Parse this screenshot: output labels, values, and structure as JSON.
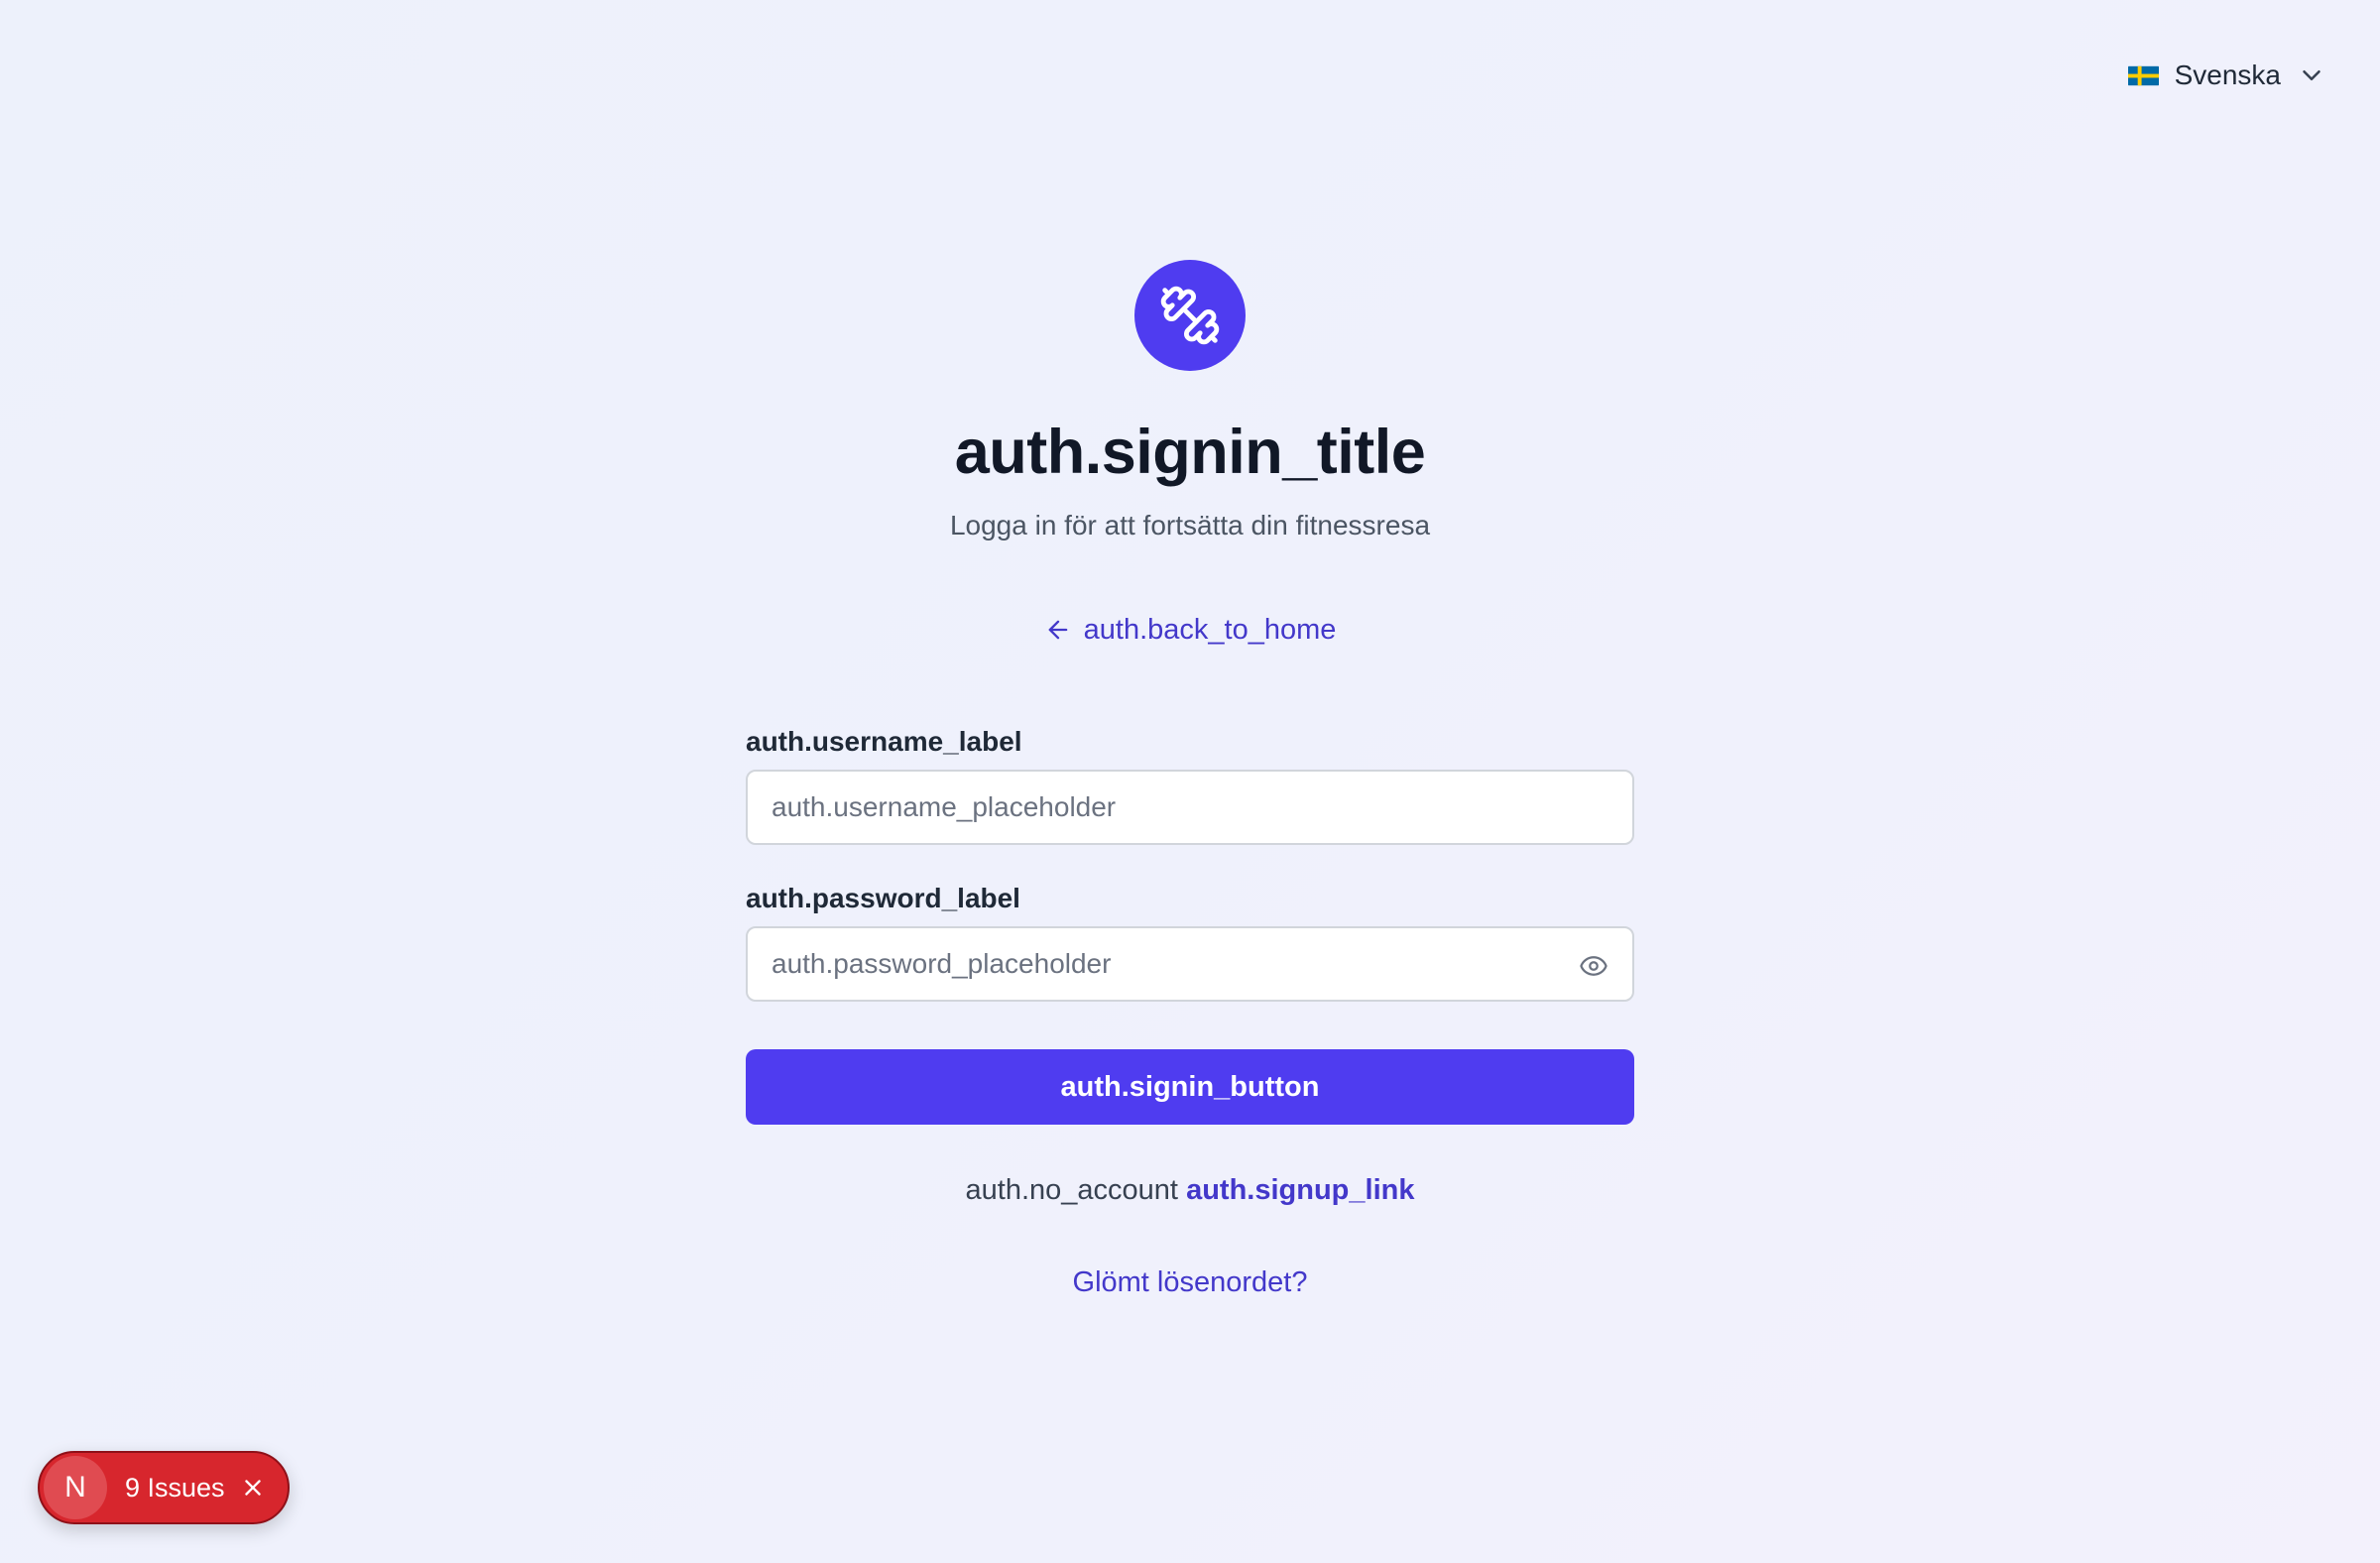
{
  "colors": {
    "accent": "#4f3cf0",
    "link": "#4338ca",
    "badge_red": "#d7262d"
  },
  "language": {
    "flag": "swedish-flag-icon",
    "label": "Svenska"
  },
  "logo": {
    "icon": "dumbbell-icon"
  },
  "auth": {
    "title": "auth.signin_title",
    "subtitle": "Logga in för att fortsätta din fitnessresa",
    "back_to_home": "auth.back_to_home",
    "username_label": "auth.username_label",
    "username_placeholder": "auth.username_placeholder",
    "username_value": "",
    "password_label": "auth.password_label",
    "password_placeholder": "auth.password_placeholder",
    "password_value": "",
    "signin_button": "auth.signin_button",
    "no_account": "auth.no_account",
    "signup_link": "auth.signup_link",
    "forgot_password": "Glömt lösenordet?"
  },
  "dev_overlay": {
    "logo_letter": "N",
    "issues_label": "9 Issues"
  }
}
